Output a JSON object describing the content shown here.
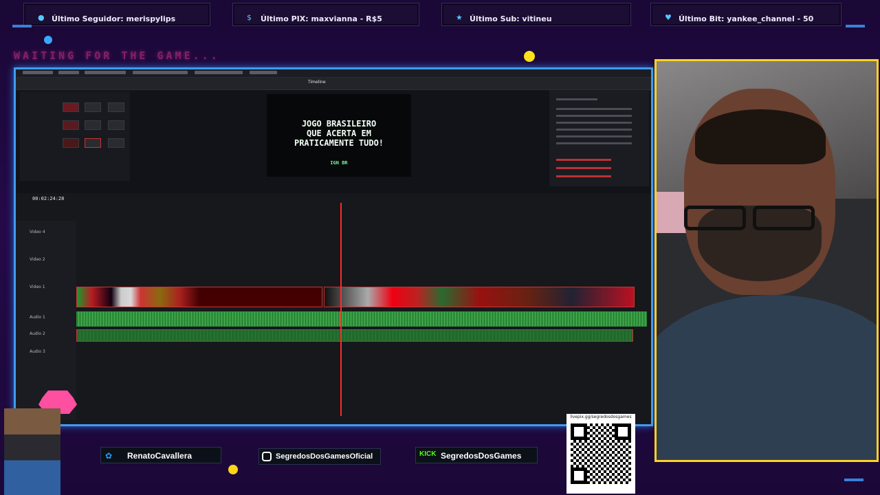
{
  "alerts": {
    "follower": "Último Seguidor: merispylips",
    "pix": "Último PIX: maxvianna - R$5",
    "sub": "Último Sub: vitineu",
    "bit": "Último Bit: yankee_channel - 50"
  },
  "waiting_text": "WAITING FOR THE GAME...",
  "editor": {
    "timecode": "00:02:24:28",
    "viewer_title": "JOGO BRASILEIRO\nQUE ACERTA EM\nPRATICAMENTE TUDO!",
    "viewer_sub": "IGN BR",
    "tracks": [
      "Video 4",
      "Video 2",
      "Video 1",
      "Audio 1",
      "Audio 2",
      "Audio 3"
    ]
  },
  "social": {
    "twitter": "RenatoCavallera",
    "instagram": "SegredosDosGamesOficial",
    "kick": "SegredosDosGames",
    "kick_badge": "KICK",
    "qr_url": "livepix.gg/segredosdosgames"
  },
  "colors": {
    "accent_blue": "#3f9bf0",
    "cam_border": "#ffd323",
    "playhead": "#ff2a2a",
    "waiting": "#ff3fa5"
  }
}
